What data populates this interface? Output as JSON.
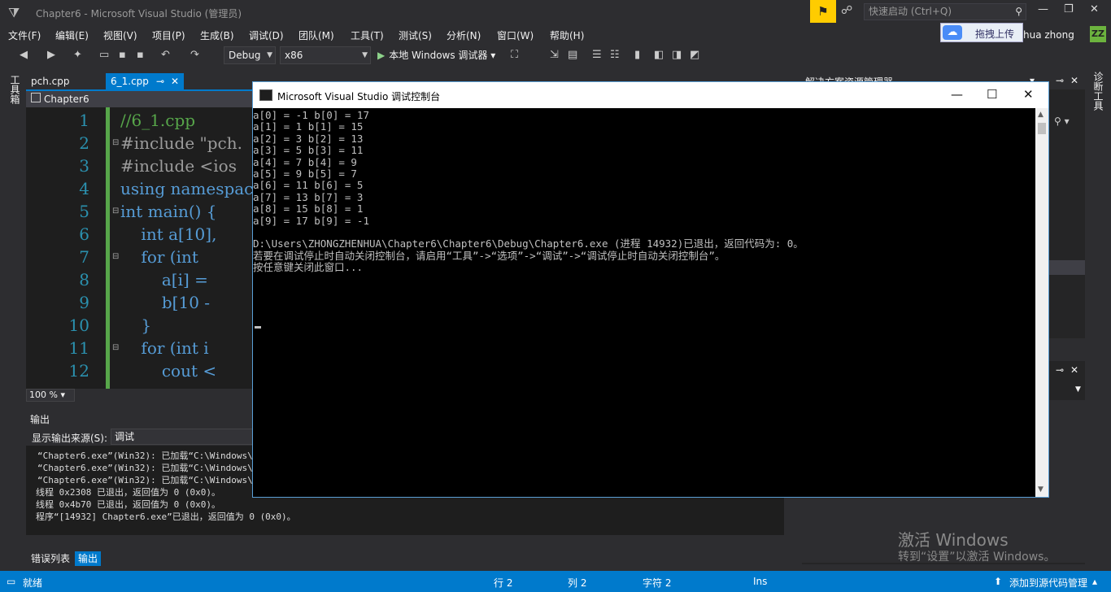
{
  "title_bar": {
    "window_title": "Chapter6 - Microsoft Visual Studio (管理员)",
    "quick_launch_placeholder": "快速启动 (Ctrl+Q)",
    "upload_label": "拖拽上传",
    "user_name": "hua zhong",
    "avatar_initials": "ZZ"
  },
  "menu": [
    "文件(F)",
    "编辑(E)",
    "视图(V)",
    "项目(P)",
    "生成(B)",
    "调试(D)",
    "团队(M)",
    "工具(T)",
    "测试(S)",
    "分析(N)",
    "窗口(W)",
    "帮助(H)"
  ],
  "toolbar": {
    "config": "Debug",
    "platform": "x86",
    "run_label": "本地 Windows 调试器"
  },
  "left_strip": "工具箱",
  "right_strip": "诊断工具",
  "tabs": [
    {
      "label": "pch.cpp"
    },
    {
      "label": "6_1.cpp"
    }
  ],
  "nav_scope": "Chapter6",
  "editor": {
    "lines": [
      {
        "num": "1",
        "text": "//6_1.cpp"
      },
      {
        "num": "2",
        "text": "#include \"pch."
      },
      {
        "num": "3",
        "text": "#include <ios"
      },
      {
        "num": "4",
        "text": "using namespac"
      },
      {
        "num": "5",
        "text": "int main() {"
      },
      {
        "num": "6",
        "text": "    int a[10],"
      },
      {
        "num": "7",
        "text": "    for (int "
      },
      {
        "num": "8",
        "text": "        a[i] ="
      },
      {
        "num": "9",
        "text": "        b[10 -"
      },
      {
        "num": "10",
        "text": "    }"
      },
      {
        "num": "11",
        "text": "    for (int i"
      },
      {
        "num": "12",
        "text": "        cout <"
      }
    ],
    "zoom": "100 %"
  },
  "output": {
    "title": "输出",
    "source_label": "显示输出来源(S):",
    "source_value": "调试",
    "lines": [
      "“Chapter6.exe”(Win32): 已加载“C:\\Windows\\",
      "“Chapter6.exe”(Win32): 已加载“C:\\Windows\\",
      "“Chapter6.exe”(Win32): 已加载“C:\\Windows\\",
      "线程 0x2308 已退出，返回值为 0 (0x0)。",
      "线程 0x4b70 已退出，返回值为 0 (0x0)。",
      "程序“[14932] Chapter6.exe”已退出，返回值为 0 (0x0)。"
    ],
    "tabs": [
      "错误列表",
      "输出"
    ]
  },
  "right_panel": {
    "solution_title": "解决方案资源管理器"
  },
  "console": {
    "title": "Microsoft Visual Studio 调试控制台",
    "lines": [
      "a[0] = -1 b[0] = 17",
      "a[1] = 1 b[1] = 15",
      "a[2] = 3 b[2] = 13",
      "a[3] = 5 b[3] = 11",
      "a[4] = 7 b[4] = 9",
      "a[5] = 9 b[5] = 7",
      "a[6] = 11 b[6] = 5",
      "a[7] = 13 b[7] = 3",
      "a[8] = 15 b[8] = 1",
      "a[9] = 17 b[9] = -1",
      "",
      "D:\\Users\\ZHONGZHENHUA\\Chapter6\\Chapter6\\Debug\\Chapter6.exe (进程 14932)已退出，返回代码为: 0。",
      "若要在调试停止时自动关闭控制台，请启用“工具”->“选项”->“调试”->“调试停止时自动关闭控制台”。",
      "按任意键关闭此窗口..."
    ]
  },
  "watermark": {
    "line1": "激活 Windows",
    "line2": "转到“设置”以激活 Windows。"
  },
  "status": {
    "ready": "就绪",
    "row": "行 2",
    "col": "列 2",
    "char": "字符 2",
    "ins": "Ins",
    "source_control": "添加到源代码管理"
  },
  "colors": {
    "accent": "#007acc",
    "background": "#2d2d30",
    "editor_bg": "#1e1e1e"
  }
}
